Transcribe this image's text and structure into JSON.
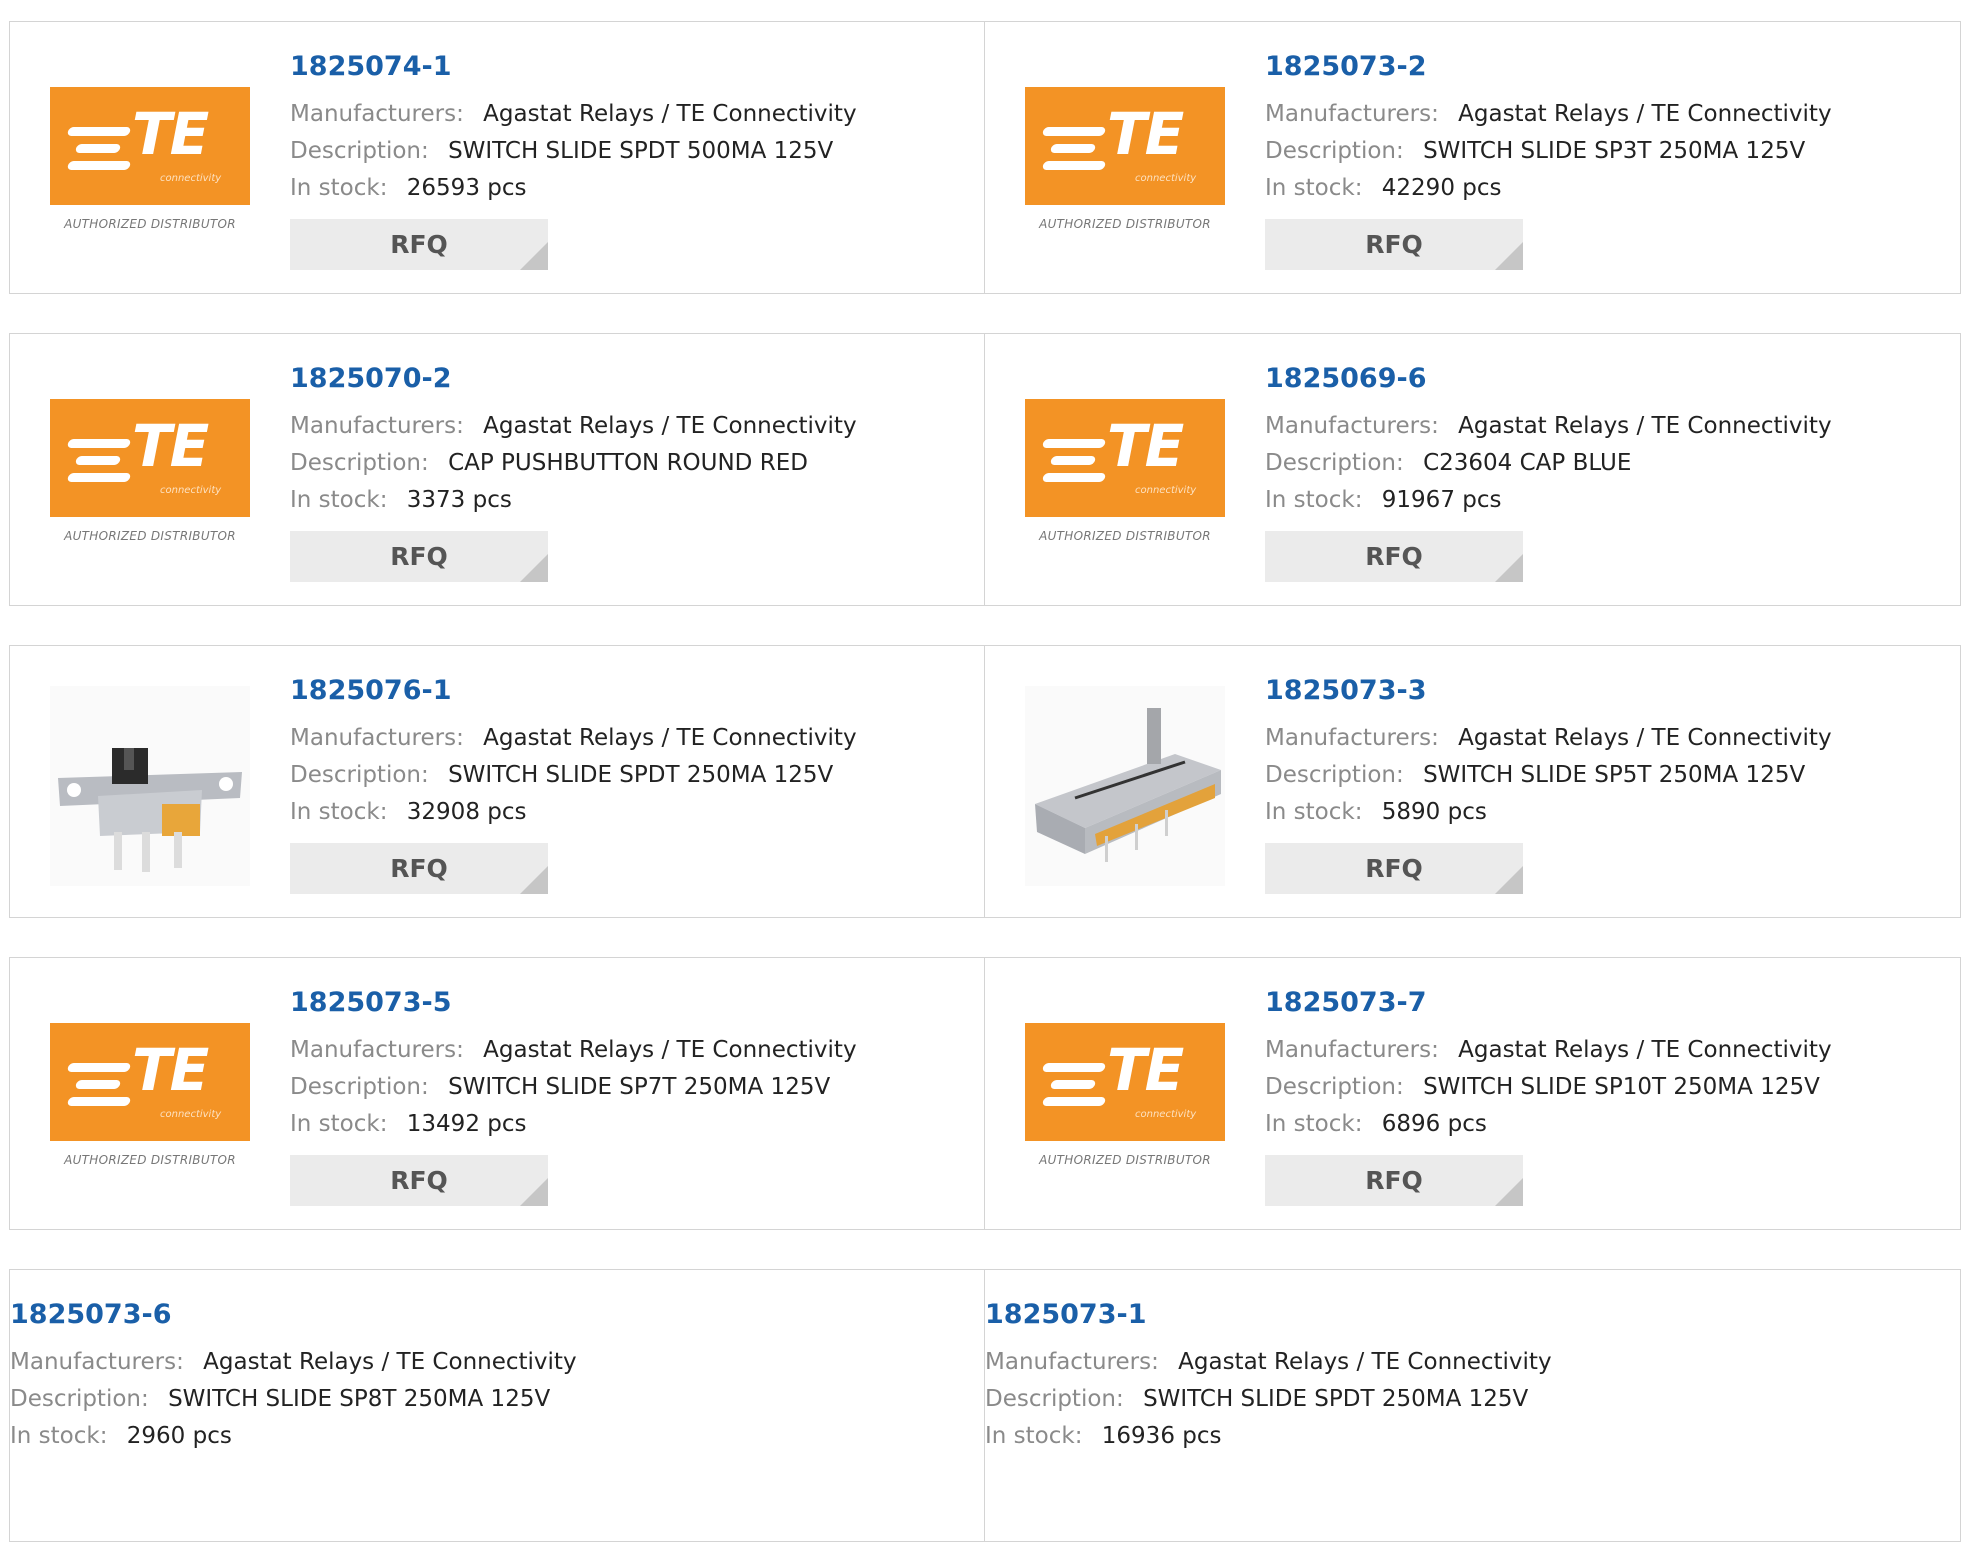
{
  "labels": {
    "manufacturers": "Manufacturers:",
    "description": "Description:",
    "in_stock": "In stock:",
    "rfq": "RFQ",
    "logo_te": "TE",
    "logo_sub": "connectivity",
    "logo_dist": "AUTHORIZED DISTRIBUTOR"
  },
  "colors": {
    "part_number": "#1a5fa8",
    "logo_orange": "#f39325"
  },
  "products": [
    {
      "pn": "1825074-1",
      "manufacturer": "Agastat Relays / TE Connectivity",
      "description": "SWITCH SLIDE SPDT 500MA 125V",
      "stock": "26593 pcs",
      "image": "te-logo"
    },
    {
      "pn": "1825073-2",
      "manufacturer": "Agastat Relays / TE Connectivity",
      "description": "SWITCH SLIDE SP3T 250MA 125V",
      "stock": "42290 pcs",
      "image": "te-logo"
    },
    {
      "pn": "1825070-2",
      "manufacturer": "Agastat Relays / TE Connectivity",
      "description": "CAP PUSHBUTTON ROUND RED",
      "stock": "3373 pcs",
      "image": "te-logo"
    },
    {
      "pn": "1825069-6",
      "manufacturer": "Agastat Relays / TE Connectivity",
      "description": "C23604 CAP BLUE",
      "stock": "91967 pcs",
      "image": "te-logo"
    },
    {
      "pn": "1825076-1",
      "manufacturer": "Agastat Relays / TE Connectivity",
      "description": "SWITCH SLIDE SPDT 250MA 125V",
      "stock": "32908 pcs",
      "image": "slide-switch-photo"
    },
    {
      "pn": "1825073-3",
      "manufacturer": "Agastat Relays / TE Connectivity",
      "description": "SWITCH SLIDE SP5T 250MA 125V",
      "stock": "5890 pcs",
      "image": "multi-slide-switch-photo"
    },
    {
      "pn": "1825073-5",
      "manufacturer": "Agastat Relays / TE Connectivity",
      "description": "SWITCH SLIDE SP7T 250MA 125V",
      "stock": "13492 pcs",
      "image": "te-logo"
    },
    {
      "pn": "1825073-7",
      "manufacturer": "Agastat Relays / TE Connectivity",
      "description": "SWITCH SLIDE SP10T 250MA 125V",
      "stock": "6896 pcs",
      "image": "te-logo"
    },
    {
      "pn": "1825073-6",
      "manufacturer": "Agastat Relays / TE Connectivity",
      "description": "SWITCH SLIDE SP8T 250MA 125V",
      "stock": "2960 pcs",
      "image": "none"
    },
    {
      "pn": "1825073-1",
      "manufacturer": "Agastat Relays / TE Connectivity",
      "description": "SWITCH SLIDE SPDT 250MA 125V",
      "stock": "16936 pcs",
      "image": "none"
    }
  ]
}
